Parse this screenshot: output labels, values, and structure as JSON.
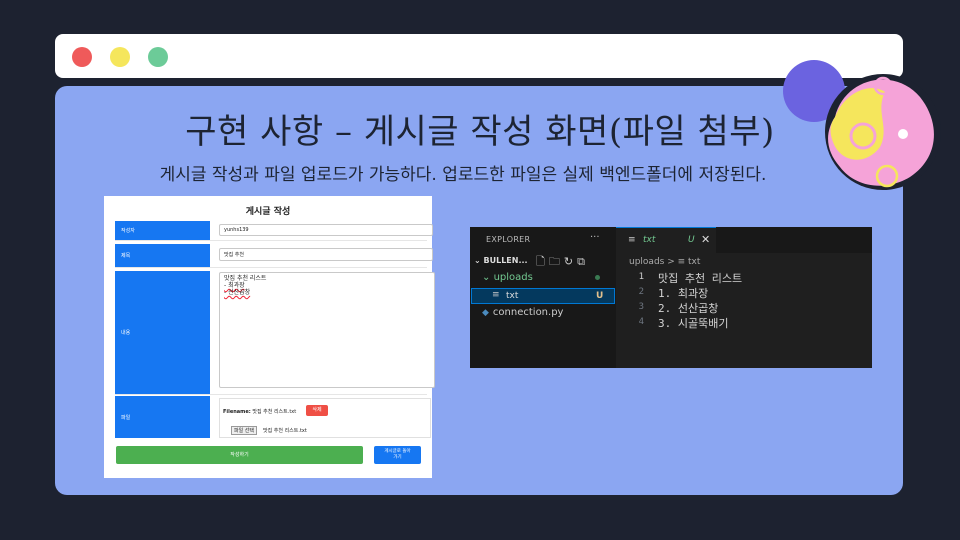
{
  "window": {
    "controls": [
      "close",
      "minimize",
      "maximize"
    ]
  },
  "slide": {
    "title": "구현 사항 – 게시글 작성 화면(파일 첨부)",
    "subtitle": "게시글 작성과 파일 업로드가 가능하다. 업로드한 파일은 실제 백엔드폴더에 저장된다."
  },
  "form": {
    "title": "게시글 작성",
    "author_label": "작성자",
    "author_value": "yunhs139",
    "subject_label": "제목",
    "subject_value": "맛집 추천",
    "content_label": "내용",
    "content_lines": [
      "맛집 추천 리스트",
      "- 최과장",
      "- 선산곱창"
    ],
    "file_label": "파일",
    "filename_prefix": "Filename:",
    "filename_value": "맛집 추천 리스트.txt",
    "delete_label": "삭제",
    "choose_file_label": "파일 선택",
    "chosen_file_text": "맛집 추천 리스트.txt",
    "submit_label": "작성하기",
    "goto_label_1": "게시글로 돌아",
    "goto_label_2": "가기"
  },
  "vscode": {
    "explorer_title": "EXPLORER",
    "more": "···",
    "root_label": "BULLEN...",
    "uploads_label": "uploads",
    "txt_label": "txt",
    "txt_status": "U",
    "connection_label": "connection.py",
    "tab_label": "txt",
    "tab_status": "U",
    "tab_close": "✕",
    "breadcrumb": "uploads  >  ≡  txt",
    "lines": [
      {
        "num": "1",
        "text": "맛집 추천 리스트"
      },
      {
        "num": "2",
        "text": "1. 최과장"
      },
      {
        "num": "3",
        "text": "2. 선산곱창"
      },
      {
        "num": "4",
        "text": "3. 시골뚝배기"
      }
    ]
  },
  "colors": {
    "background": "#1d2230",
    "slide": "#8ba6f2",
    "form_label_blue": "#1677f2",
    "submit_green": "#4caf50",
    "delete_red": "#ef4f45",
    "git_untracked_green": "#73c991"
  }
}
